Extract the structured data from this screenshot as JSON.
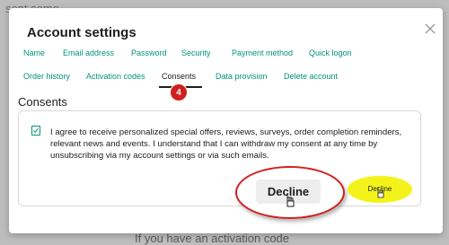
{
  "background": {
    "top_text": "sent some...",
    "bottom_text": "If you have an activation code"
  },
  "dialog": {
    "title": "Account settings"
  },
  "tabs_row1": [
    "Name",
    "Email address",
    "Password",
    "Security",
    "Payment method",
    "Quick logon"
  ],
  "tabs_row2": [
    "Order history",
    "Activation codes",
    "Consents",
    "Data provision",
    "Delete account"
  ],
  "active_tab": "Consents",
  "step_badge": "4",
  "section": {
    "title": "Consents",
    "consent_text": "I agree to receive personalized special offers, reviews, surveys, order completion reminders, relevant news and events. I understand that I can withdraw my consent at any time by unsubscribing via my account settings or via such emails."
  },
  "decline_button": {
    "label": "Decline",
    "zoom_label": "Decline"
  },
  "colors": {
    "accent": "#00937a",
    "annotation_red": "#d32020",
    "highlight_yellow": "#f3f31b"
  },
  "icons": {
    "close": "close-icon",
    "checkbox": "checkbox-icon",
    "cursor": "hand-pointer-icon"
  }
}
